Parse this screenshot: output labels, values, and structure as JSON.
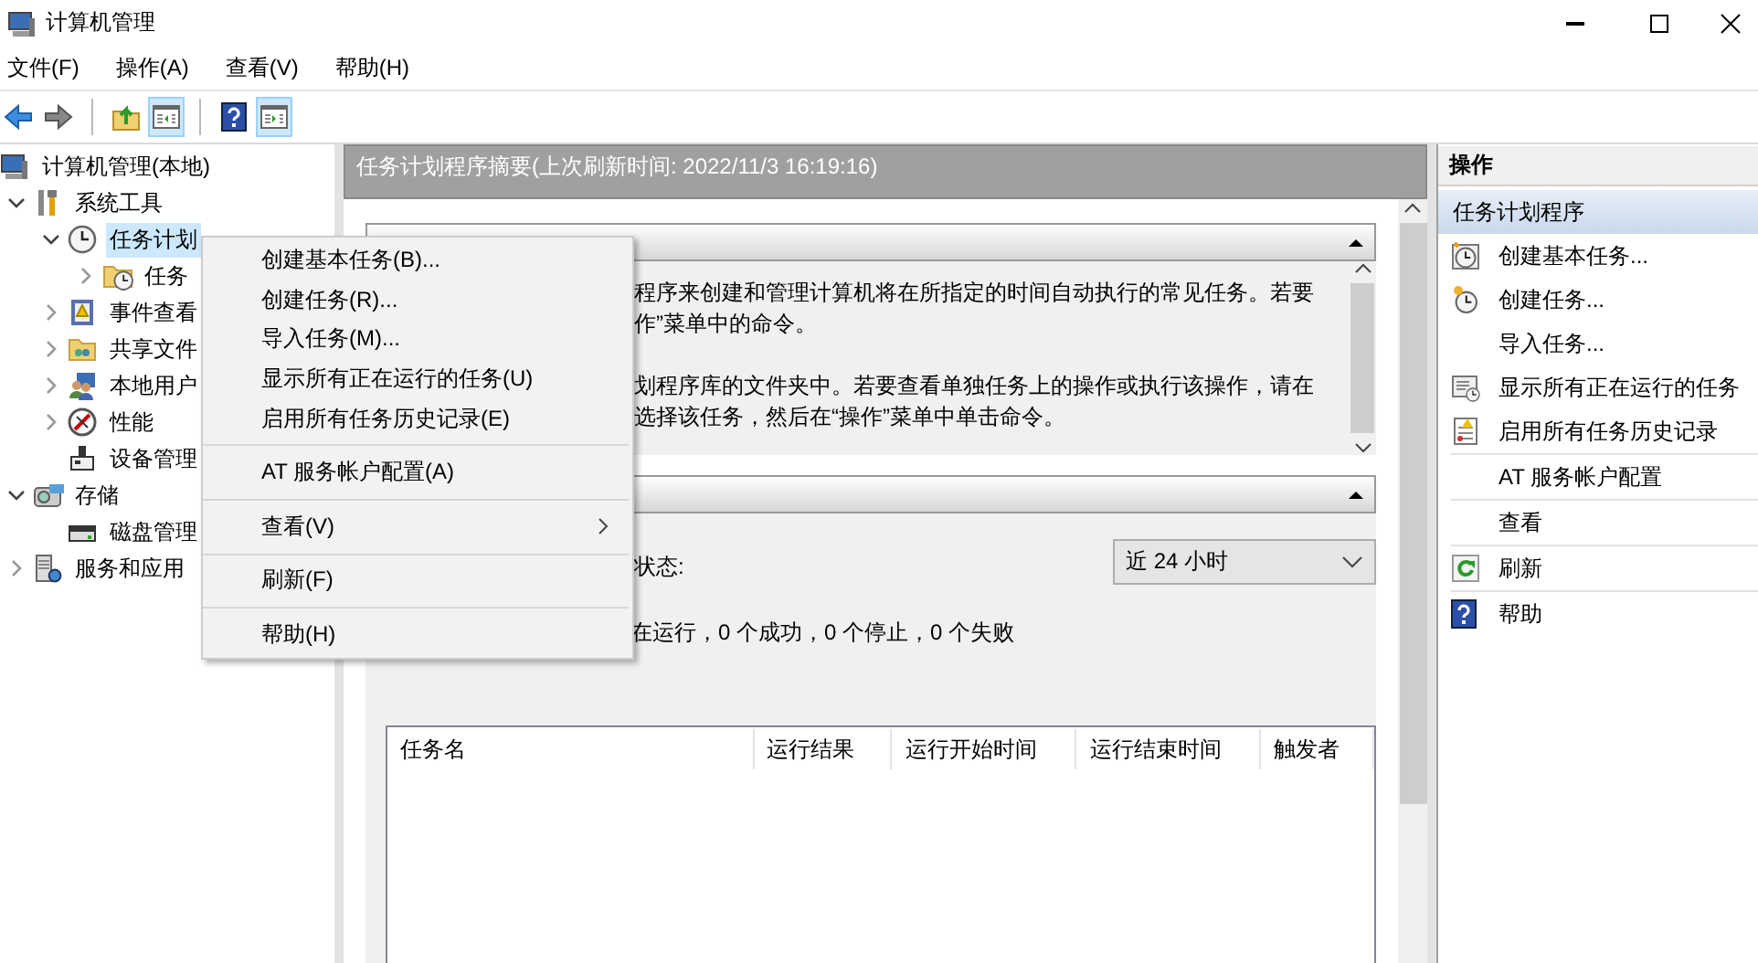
{
  "window": {
    "title": "计算机管理"
  },
  "menu_bar": [
    "文件(F)",
    "操作(A)",
    "查看(V)",
    "帮助(H)"
  ],
  "toolbar": [
    {
      "kind": "back",
      "pressed": false
    },
    {
      "kind": "forward",
      "pressed": false
    },
    {
      "kind": "separator",
      "pressed": false
    },
    {
      "kind": "up",
      "pressed": false
    },
    {
      "kind": "tree",
      "pressed": true
    },
    {
      "kind": "separator",
      "pressed": false
    },
    {
      "kind": "help",
      "pressed": false
    },
    {
      "kind": "actions",
      "pressed": true
    }
  ],
  "tree": [
    {
      "label": "计算机管理(本地)",
      "kind": "computer",
      "selected": false,
      "children": [
        {
          "label": "系统工具",
          "kind": "tools",
          "expandable": true,
          "expanded": true,
          "selected": false,
          "children": [
            {
              "label": "任务计划",
              "kind": "clock",
              "expandable": true,
              "expanded": true,
              "selected": true,
              "children": [
                {
                  "label": "任务",
                  "kind": "folder",
                  "expandable": true,
                  "expanded": false,
                  "selected": false
                }
              ]
            },
            {
              "label": "事件查看",
              "kind": "log",
              "expandable": true,
              "expanded": false,
              "selected": false
            },
            {
              "label": "共享文件",
              "kind": "share",
              "expandable": true,
              "expanded": false,
              "selected": false
            },
            {
              "label": "本地用户",
              "kind": "users",
              "expandable": true,
              "expanded": false,
              "selected": false
            },
            {
              "label": "性能",
              "kind": "perf",
              "expandable": true,
              "expanded": false,
              "selected": false
            },
            {
              "label": "设备管理",
              "kind": "device",
              "expandable": false,
              "expanded": false,
              "selected": false
            }
          ]
        },
        {
          "label": "存储",
          "kind": "storage",
          "expandable": true,
          "expanded": true,
          "selected": false,
          "children": [
            {
              "label": "磁盘管理",
              "kind": "disk",
              "expandable": false,
              "expanded": false,
              "selected": false
            }
          ]
        },
        {
          "label": "服务和应用",
          "kind": "services",
          "expandable": true,
          "expanded": false,
          "selected": false
        }
      ]
    }
  ],
  "center": {
    "header": "任务计划程序摘要(上次刷新时间: 2022/11/3 16:19:16)",
    "overview": [
      [
        "程序来创建和管理计算机将在所指定的时间自动执行的常见任务。若要",
        "作”菜单中的命令。"
      ],
      [
        "划程序库的文件夹中。若要查看单独任务上的操作或执行该操作，请在",
        "选择该任务，然后在“操作”菜单中单击命令。"
      ]
    ],
    "status_label": "状态:",
    "range": {
      "value": "近 24 小时"
    },
    "summary": "在运行，0 个成功，0 个停止，0 个失败",
    "table": {
      "columns": [
        "任务名",
        "运行结果",
        "运行开始时间",
        "运行结束时间",
        "触发者"
      ]
    }
  },
  "actions": {
    "title": "操作",
    "group": "任务计划程序",
    "items": [
      {
        "label": "创建基本任务...",
        "kind": "basic",
        "divider": false
      },
      {
        "label": "创建任务...",
        "kind": "task",
        "divider": false
      },
      {
        "label": "导入任务...",
        "kind": "none",
        "divider": false
      },
      {
        "label": "显示所有正在运行的任务",
        "kind": "running",
        "divider": false
      },
      {
        "label": "启用所有任务历史记录",
        "kind": "history",
        "divider": false
      },
      {
        "label": "AT 服务帐户配置",
        "kind": "none",
        "divider": true
      },
      {
        "label": "查看",
        "kind": "none",
        "divider": true
      },
      {
        "label": "刷新",
        "kind": "refresh",
        "divider": true
      },
      {
        "label": "帮助",
        "kind": "help",
        "divider": true
      }
    ]
  },
  "context_menu": [
    {
      "kind": "item",
      "label": "创建基本任务(B)..."
    },
    {
      "kind": "item",
      "label": "创建任务(R)..."
    },
    {
      "kind": "item",
      "label": "导入任务(M)..."
    },
    {
      "kind": "item",
      "label": "显示所有正在运行的任务(U)"
    },
    {
      "kind": "item",
      "label": "启用所有任务历史记录(E)"
    },
    {
      "kind": "separator"
    },
    {
      "kind": "item",
      "label": "AT 服务帐户配置(A)"
    },
    {
      "kind": "separator"
    },
    {
      "kind": "submenu",
      "label": "查看(V)"
    },
    {
      "kind": "separator"
    },
    {
      "kind": "item",
      "label": "刷新(F)"
    },
    {
      "kind": "separator"
    },
    {
      "kind": "item",
      "label": "帮助(H)"
    }
  ]
}
